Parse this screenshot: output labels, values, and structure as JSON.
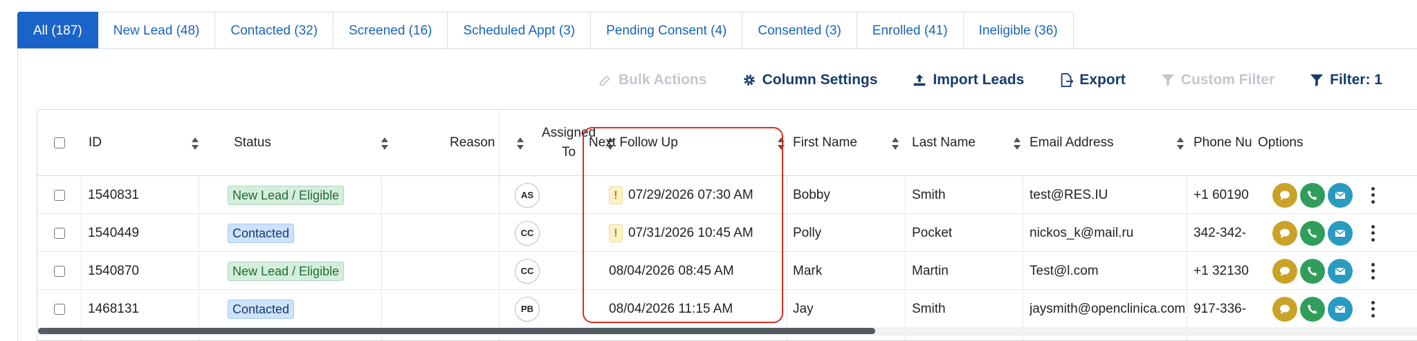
{
  "tabs": [
    {
      "label": "All (187)"
    },
    {
      "label": "New Lead (48)"
    },
    {
      "label": "Contacted (32)"
    },
    {
      "label": "Screened (16)"
    },
    {
      "label": "Scheduled Appt (3)"
    },
    {
      "label": "Pending Consent (4)"
    },
    {
      "label": "Consented (3)"
    },
    {
      "label": "Enrolled (41)"
    },
    {
      "label": "Ineligible (36)"
    }
  ],
  "toolbar": {
    "bulk_actions": "Bulk Actions",
    "column_settings": "Column Settings",
    "import_leads": "Import Leads",
    "export": "Export",
    "custom_filter": "Custom Filter",
    "filter": "Filter: 1"
  },
  "columns": {
    "id": "ID",
    "status": "Status",
    "reason": "Reason",
    "assigned_1": "Assigned",
    "assigned_2": "To",
    "next_follow_up": "Next Follow Up",
    "first_name": "First Name",
    "last_name": "Last Name",
    "email": "Email Address",
    "phone": "Phone Nu",
    "options": "Options"
  },
  "rows": [
    {
      "id": "1540831",
      "status": "New Lead / Eligible",
      "assigned": "AS",
      "warn": "!",
      "follow_up": "07/29/2026 07:30 AM",
      "first": "Bobby",
      "last": "Smith",
      "email": "test@RES.IU",
      "phone": "+1 60190"
    },
    {
      "id": "1540449",
      "status": "Contacted",
      "assigned": "CC",
      "warn": "!",
      "follow_up": "07/31/2026 10:45 AM",
      "first": "Polly",
      "last": "Pocket",
      "email": "nickos_k@mail.ru",
      "phone": "342-342-"
    },
    {
      "id": "1540870",
      "status": "New Lead / Eligible",
      "assigned": "CC",
      "warn": "",
      "follow_up": "08/04/2026 08:45 AM",
      "first": "Mark",
      "last": "Martin",
      "email": "Test@l.com",
      "phone": "+1 32130"
    },
    {
      "id": "1468131",
      "status": "Contacted",
      "assigned": "PB",
      "warn": "",
      "follow_up": "08/04/2026 11:15 AM",
      "first": "Jay",
      "last": "Smith",
      "email": "jaysmith@openclinica.com",
      "phone": "917-336-"
    }
  ],
  "colors": {
    "accent": "#1a63c8",
    "highlight": "#e02a1f"
  }
}
